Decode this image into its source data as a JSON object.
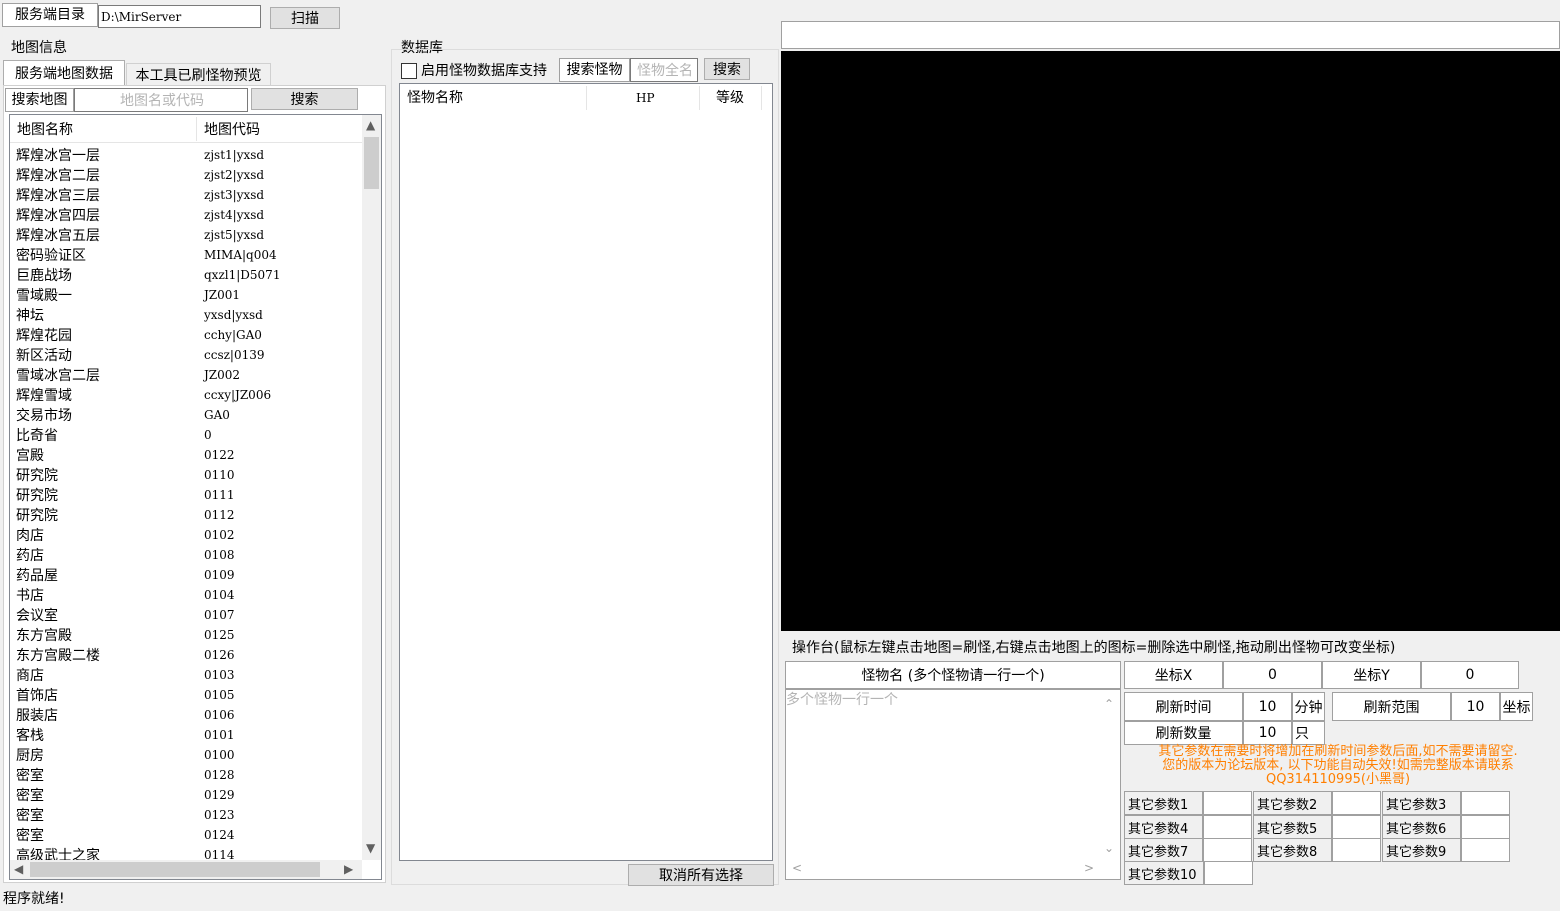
{
  "top": {
    "dir_label": "服务端目录",
    "dir_value": "D:\\MirServer",
    "scan_button": "扫描"
  },
  "map_panel": {
    "group_title": "地图信息",
    "tabs": [
      "服务端地图数据",
      "本工具已刷怪物预览"
    ],
    "search_label": "搜索地图",
    "search_placeholder": "地图名或代码",
    "search_button": "搜索",
    "columns": [
      "地图名称",
      "地图代码"
    ],
    "rows": [
      [
        "辉煌冰宫一层",
        "zjst1|yxsd"
      ],
      [
        "辉煌冰宫二层",
        "zjst2|yxsd"
      ],
      [
        "辉煌冰宫三层",
        "zjst3|yxsd"
      ],
      [
        "辉煌冰宫四层",
        "zjst4|yxsd"
      ],
      [
        "辉煌冰宫五层",
        "zjst5|yxsd"
      ],
      [
        "密码验证区",
        "MIMA|q004"
      ],
      [
        "巨鹿战场",
        "qxzl1|D5071"
      ],
      [
        "雪域殿一",
        "JZ001"
      ],
      [
        "神坛",
        "yxsd|yxsd"
      ],
      [
        "辉煌花园",
        "cchy|GA0"
      ],
      [
        "新区活动",
        "ccsz|0139"
      ],
      [
        "雪域冰宫二层",
        "JZ002"
      ],
      [
        "辉煌雪域",
        "ccxy|JZ006"
      ],
      [
        "交易市场",
        "GA0"
      ],
      [
        "比奇省",
        "0"
      ],
      [
        "宫殿",
        "0122"
      ],
      [
        "研究院",
        "0110"
      ],
      [
        "研究院",
        "0111"
      ],
      [
        "研究院",
        "0112"
      ],
      [
        "肉店",
        "0102"
      ],
      [
        "药店",
        "0108"
      ],
      [
        "药品屋",
        "0109"
      ],
      [
        "书店",
        "0104"
      ],
      [
        "会议室",
        "0107"
      ],
      [
        "东方宫殿",
        "0125"
      ],
      [
        "东方宫殿二楼",
        "0126"
      ],
      [
        "商店",
        "0103"
      ],
      [
        "首饰店",
        "0105"
      ],
      [
        "服装店",
        "0106"
      ],
      [
        "客栈",
        "0101"
      ],
      [
        "厨房",
        "0100"
      ],
      [
        "密室",
        "0128"
      ],
      [
        "密室",
        "0129"
      ],
      [
        "密室",
        "0123"
      ],
      [
        "密室",
        "0124"
      ],
      [
        "高级武士之家",
        "0114"
      ]
    ]
  },
  "db_panel": {
    "group_title": "数据库",
    "enable_checkbox": "启用怪物数据库支持",
    "search_label": "搜索怪物",
    "search_placeholder": "怪物全名",
    "search_button": "搜索",
    "columns": [
      "怪物名称",
      "HP",
      "等级"
    ],
    "clear_button": "取消所有选择"
  },
  "console": {
    "title": "操作台(鼠标左键点击地图=刷怪,右键点击地图上的图标=删除选中刷怪,拖动刷出怪物可改变坐标)",
    "monster_header": "怪物名 (多个怪物请一行一个)",
    "monster_placeholder": "多个怪物一行一个",
    "coord_x_label": "坐标X",
    "coord_x_value": "0",
    "coord_y_label": "坐标Y",
    "coord_y_value": "0",
    "refresh_time_label": "刷新时间",
    "refresh_time_value": "10",
    "refresh_time_unit": "分钟",
    "refresh_range_label": "刷新范围",
    "refresh_range_value": "10",
    "refresh_range_unit": "坐标",
    "refresh_count_label": "刷新数量",
    "refresh_count_value": "10",
    "refresh_count_unit": "只",
    "notice_line1": "其它参数在需要时将增加在刷新时间参数后面,如不需要请留空.",
    "notice_line2": "您的版本为论坛版本, 以下功能自动失效!如需完整版本请联系",
    "notice_line3": "QQ314110995(小黑哥)",
    "notice_color": "#ff7f00",
    "params": [
      "其它参数1",
      "其它参数2",
      "其它参数3",
      "其它参数4",
      "其它参数5",
      "其它参数6",
      "其它参数7",
      "其它参数8",
      "其它参数9",
      "其它参数10"
    ]
  },
  "status": {
    "text": "程序就绪!"
  }
}
